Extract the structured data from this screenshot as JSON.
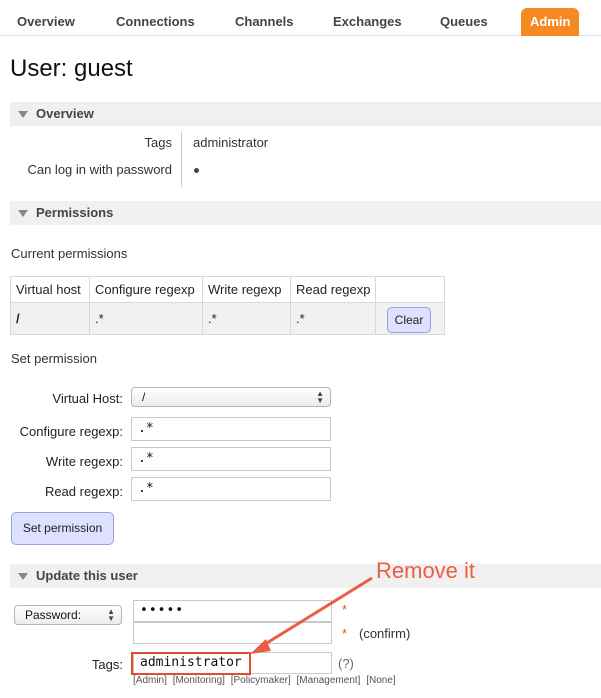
{
  "nav": {
    "items": [
      {
        "label": "Overview",
        "active": false
      },
      {
        "label": "Connections",
        "active": false
      },
      {
        "label": "Channels",
        "active": false
      },
      {
        "label": "Exchanges",
        "active": false
      },
      {
        "label": "Queues",
        "active": false
      },
      {
        "label": "Admin",
        "active": true
      }
    ],
    "accent": "#f58a22"
  },
  "page_title": "User: guest",
  "overview": {
    "header": "Overview",
    "tags_label": "Tags",
    "tags_value": "administrator",
    "login_label": "Can log in with password",
    "login_value": "•"
  },
  "permissions": {
    "header": "Permissions",
    "current_label": "Current permissions",
    "columns": [
      "Virtual host",
      "Configure regexp",
      "Write regexp",
      "Read regexp"
    ],
    "rows": [
      {
        "vhost": "/",
        "configure": ".*",
        "write": ".*",
        "read": ".*",
        "action": "Clear"
      }
    ],
    "set_label": "Set permission",
    "form": {
      "vhost_label": "Virtual Host:",
      "vhost_value": "/",
      "configure_label": "Configure regexp:",
      "configure_value": ".*",
      "write_label": "Write regexp:",
      "write_value": ".*",
      "read_label": "Read regexp:",
      "read_value": ".*",
      "submit": "Set permission"
    }
  },
  "update_user": {
    "header": "Update this user",
    "password_select": "Password:",
    "password_value": "•••••",
    "required_mark": "*",
    "confirm_label": "(confirm)",
    "tags_label": "Tags:",
    "tags_value": "administrator",
    "help": "(?)",
    "tag_options": [
      "[Admin]",
      "[Monitoring]",
      "[Policymaker]",
      "[Management]",
      "[None]"
    ]
  },
  "annotation": {
    "text": "Remove it",
    "color": "#ec5e44"
  },
  "button_color": "#dde0ff"
}
